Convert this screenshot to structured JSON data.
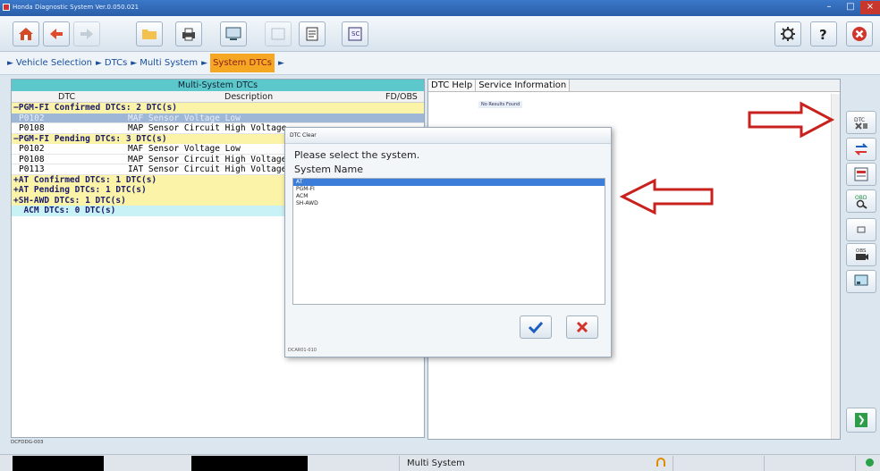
{
  "window": {
    "title": "Honda Diagnostic System Ver.0.050.021"
  },
  "breadcrumb": {
    "items": [
      "Vehicle Selection",
      "DTCs",
      "Multi System",
      "System DTCs"
    ]
  },
  "left_panel": {
    "header": "Multi-System DTCs",
    "columns": {
      "dtc": "DTC",
      "description": "Description",
      "fdobs": "FD/OBS"
    },
    "groups": [
      {
        "label": "−PGM-FI Confirmed DTCs: 2 DTC(s)",
        "style": "yellow",
        "rows": [
          {
            "code": "P0102",
            "desc": "MAF Sensor Voltage Low",
            "selected": true
          },
          {
            "code": "P0108",
            "desc": "MAP Sensor Circuit High Voltage",
            "selected": false
          }
        ]
      },
      {
        "label": "−PGM-FI Pending DTCs: 3 DTC(s)",
        "style": "yellow",
        "rows": [
          {
            "code": "P0102",
            "desc": "MAF Sensor Voltage Low",
            "selected": false
          },
          {
            "code": "P0108",
            "desc": "MAP Sensor Circuit High Voltage",
            "selected": false
          },
          {
            "code": "P0113",
            "desc": "IAT Sensor Circuit High Voltage",
            "selected": false
          }
        ]
      },
      {
        "label": "+AT Confirmed DTCs: 1 DTC(s)",
        "style": "yellow",
        "rows": []
      },
      {
        "label": "+AT Pending DTCs: 1 DTC(s)",
        "style": "yellow",
        "rows": []
      },
      {
        "label": "+SH-AWD DTCs: 1 DTC(s)",
        "style": "yellow",
        "rows": []
      },
      {
        "label": "  ACM DTCs: 0 DTC(s)",
        "style": "cyan",
        "rows": []
      }
    ],
    "footer_code": "DCFDDG-003"
  },
  "right_panel": {
    "tabs": [
      "DTC Help",
      "Service Information"
    ],
    "no_results": "No Results Found"
  },
  "dialog": {
    "title": "DTC Clear",
    "prompt": "Please select the system.",
    "list_label": "System Name",
    "options": [
      "AT",
      "PGM-FI",
      "ACM",
      "SH-AWD"
    ],
    "selected_index": 0,
    "footer_code": "DCAR01-010"
  },
  "sidebar": {
    "buttons": [
      "DTC",
      "",
      "",
      "OBD",
      "",
      "OBS",
      ""
    ]
  },
  "status_bar": {
    "text": "Multi System"
  },
  "colors": {
    "accent_orange": "#f5a623",
    "arrow_red": "#c8211e",
    "selected_blue": "#3b7dd8",
    "header_cyan": "#5cc8cc",
    "group_yellow": "#fbf3a8"
  }
}
